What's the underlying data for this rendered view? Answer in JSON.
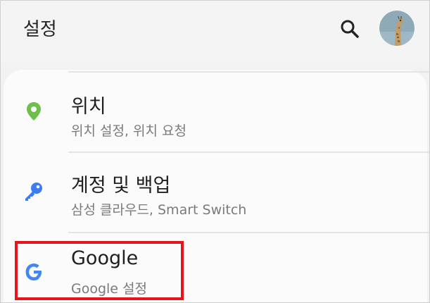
{
  "header": {
    "title": "설정"
  },
  "items": [
    {
      "label": "위치",
      "sub": "위치 설정, 위치 요청",
      "icon": "location-pin-icon",
      "color": "#6cc04a"
    },
    {
      "label": "계정 및 백업",
      "sub": "삼성 클라우드, Smart Switch",
      "icon": "key-icon",
      "color": "#3d7cf0"
    },
    {
      "label": "Google",
      "sub": "Google 설정",
      "icon": "google-icon",
      "color": "#4285f4"
    }
  ],
  "highlight_color": "#e5141e"
}
